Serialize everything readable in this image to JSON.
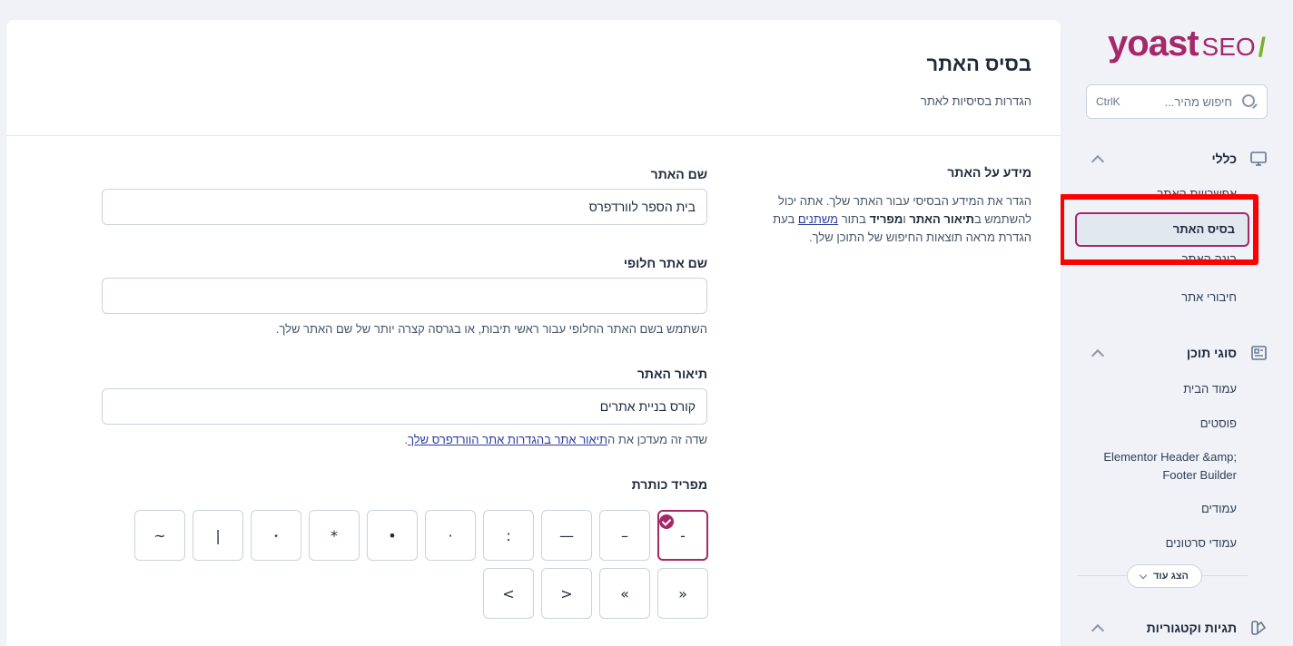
{
  "sidebar": {
    "logo": {
      "brand": "yoast",
      "product": "SEO",
      "slash": "/"
    },
    "search": {
      "placeholder": "חיפוש מהיר...",
      "shortcut": "CtrlK"
    },
    "groups": [
      {
        "title": "כללי",
        "icon": "desktop-icon",
        "items": [
          "אפשרויות האתר",
          "בסיס האתר",
          "בונה האתר",
          "חיבורי אתר"
        ]
      },
      {
        "title": "סוגי תוכן",
        "icon": "newspaper-icon",
        "items": [
          "עמוד הבית",
          "פוסטים",
          "Elementor Header &amp; Footer Builder",
          "עמודים",
          "עמודי סרטונים"
        ]
      },
      {
        "title": "תגיות וקטגוריות",
        "icon": "tag-swatch-icon",
        "items": []
      }
    ],
    "show_more": "הצג עוד",
    "active_item": "בסיס האתר"
  },
  "main": {
    "title": "בסיס האתר",
    "subtitle": "הגדרות בסיסיות לאתר",
    "info": {
      "title": "מידע על האתר",
      "desc_1": "הגדר את המידע הבסיסי עבור האתר שלך. אתה יכול להשתמש ב",
      "desc_bold_1": "תיאור האתר",
      "desc_2": " ו",
      "desc_bold_2": "מפריד",
      "desc_3": " בתור ",
      "desc_link": "משתנים",
      "desc_4": " בעת הגדרת מראה תוצאות החיפוש של התוכן שלך."
    },
    "fields": {
      "site_name": {
        "label": "שם האתר",
        "value": "בית הספר לוורדפרס"
      },
      "alt_name": {
        "label": "שם אתר חלופי",
        "value": "",
        "help": "השתמש בשם האתר החלופי עבור ראשי תיבות, או בגרסה קצרה יותר של שם האתר שלך."
      },
      "tagline": {
        "label": "תיאור האתר",
        "value": "קורס בניית אתרים",
        "help_prefix": "שדה זה מעדכן את ה",
        "help_link": "תיאור אתר בהגדרות אתר הוורדפרס שלך",
        "help_suffix": "."
      },
      "separator": {
        "label": "מפריד כותרת",
        "row1": [
          "-",
          "–",
          "—",
          ":",
          "·",
          "•",
          "*",
          "⋆",
          "|",
          "~"
        ],
        "row2": [
          "«",
          "»",
          "<",
          ">"
        ],
        "selected": "-"
      }
    }
  },
  "colors": {
    "accent": "#a4286a",
    "highlight": "#ff0000",
    "link": "#2c3e9e"
  }
}
